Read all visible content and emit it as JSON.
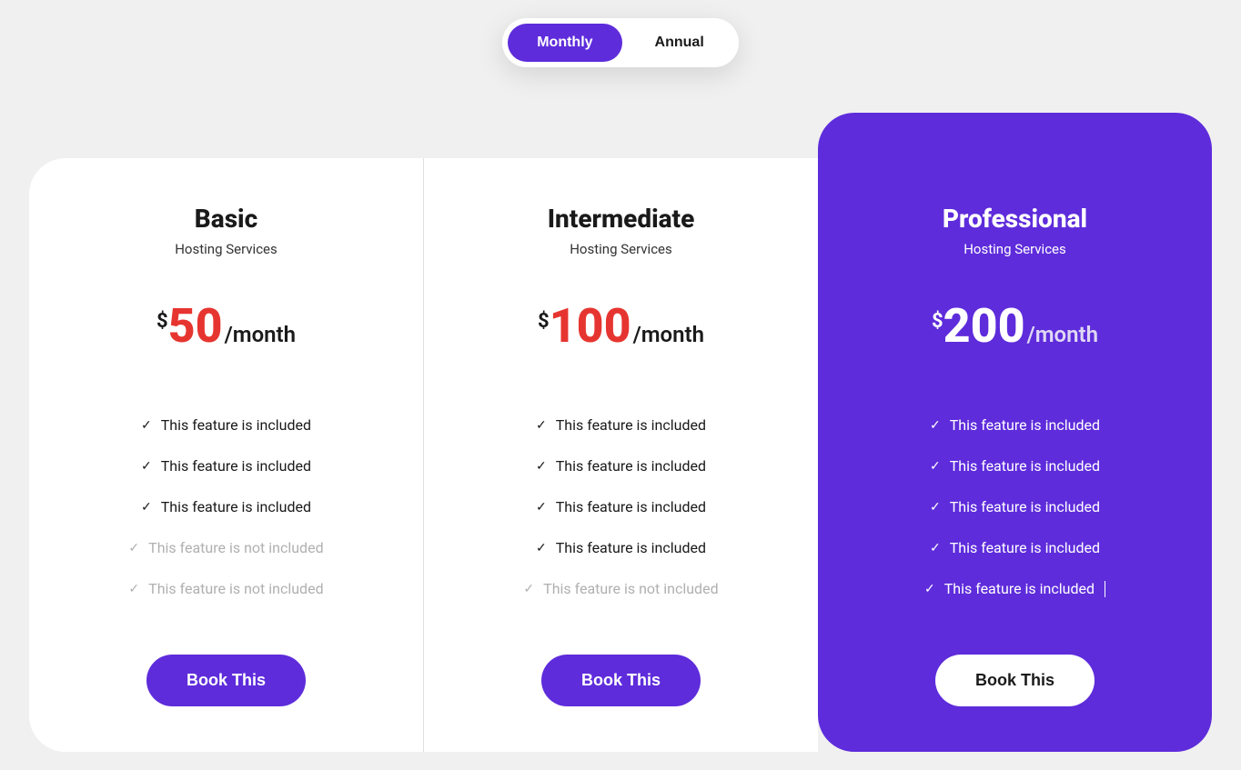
{
  "toggle": {
    "monthly": "Monthly",
    "annual": "Annual"
  },
  "plans": [
    {
      "title": "Basic",
      "subtitle": "Hosting Services",
      "currency": "$",
      "price": "50",
      "period": "/month",
      "features": [
        {
          "text": "This feature is included",
          "enabled": true
        },
        {
          "text": "This feature is included",
          "enabled": true
        },
        {
          "text": "This feature is included",
          "enabled": true
        },
        {
          "text": "This feature is not included",
          "enabled": false
        },
        {
          "text": "This feature is not included",
          "enabled": false
        }
      ],
      "cta": "Book This"
    },
    {
      "title": "Intermediate",
      "subtitle": "Hosting Services",
      "currency": "$",
      "price": "100",
      "period": "/month",
      "features": [
        {
          "text": "This feature is included",
          "enabled": true
        },
        {
          "text": "This feature is included",
          "enabled": true
        },
        {
          "text": "This feature is included",
          "enabled": true
        },
        {
          "text": "This feature is included",
          "enabled": true
        },
        {
          "text": "This feature is not included",
          "enabled": false
        }
      ],
      "cta": "Book This"
    },
    {
      "title": "Professional",
      "subtitle": "Hosting Services",
      "currency": "$",
      "price": "200",
      "period": "/month",
      "features": [
        {
          "text": "This feature is included",
          "enabled": true
        },
        {
          "text": "This feature is included",
          "enabled": true
        },
        {
          "text": "This feature is included",
          "enabled": true
        },
        {
          "text": "This feature is included",
          "enabled": true
        },
        {
          "text": "This feature is included",
          "enabled": true
        }
      ],
      "cta": "Book This"
    }
  ],
  "check_glyph": "✓"
}
